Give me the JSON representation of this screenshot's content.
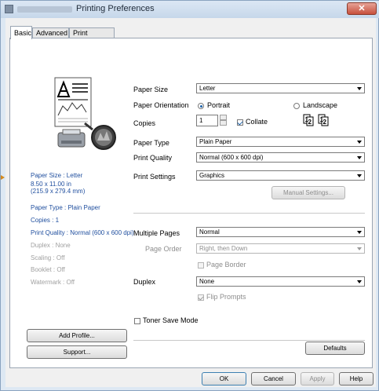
{
  "window": {
    "title": "Printing Preferences",
    "close_label": "✕"
  },
  "tabs": [
    {
      "label": "Basic"
    },
    {
      "label": "Advanced"
    },
    {
      "label": "Print Profiles"
    }
  ],
  "summary": {
    "paper_size": "Paper Size : Letter",
    "paper_dims_in": "8.50 x 11.00 in",
    "paper_dims_mm": "(215.9 x 279.4 mm)",
    "paper_type": "Paper Type : Plain Paper",
    "copies": "Copies : 1",
    "print_quality": "Print Quality : Normal (600 x 600 dpi)",
    "duplex": "Duplex : None",
    "scaling": "Scaling : Off",
    "booklet": "Booklet : Off",
    "watermark": "Watermark : Off"
  },
  "settings": {
    "paper_size_label": "Paper Size",
    "paper_size_value": "Letter",
    "orientation_label": "Paper Orientation",
    "portrait_label": "Portrait",
    "landscape_label": "Landscape",
    "copies_label": "Copies",
    "copies_value": "1",
    "collate_label": "Collate",
    "paper_type_label": "Paper Type",
    "paper_type_value": "Plain Paper",
    "print_quality_label": "Print Quality",
    "print_quality_value": "Normal (600 x 600 dpi)",
    "print_settings_label": "Print Settings",
    "print_settings_value": "Graphics",
    "manual_settings_label": "Manual Settings...",
    "multiple_pages_label": "Multiple Pages",
    "multiple_pages_value": "Normal",
    "page_order_label": "Page Order",
    "page_order_value": "Right, then Down",
    "page_border_label": "Page Border",
    "duplex_label": "Duplex",
    "duplex_value": "None",
    "flip_prompts_label": "Flip Prompts",
    "toner_save_label": "Toner Save Mode",
    "collate_icon_1": "1",
    "collate_icon_2": "2"
  },
  "buttons": {
    "add_profile": "Add Profile...",
    "support": "Support...",
    "defaults": "Defaults",
    "ok": "OK",
    "cancel": "Cancel",
    "apply": "Apply",
    "help": "Help"
  },
  "state": {
    "orientation": "portrait",
    "collate_checked": true,
    "page_border_checked": false,
    "flip_prompts_checked": true,
    "toner_save_checked": false
  },
  "colors": {
    "summary_text": "#1f4e9e",
    "summary_disabled": "#a0a0a0",
    "close_button": "#c7503c"
  },
  "icons": {
    "preview": "document-preview-icon",
    "magnifier": "magnifier-icon",
    "printer": "printer-icon",
    "collate": "collate-pages-icon"
  }
}
